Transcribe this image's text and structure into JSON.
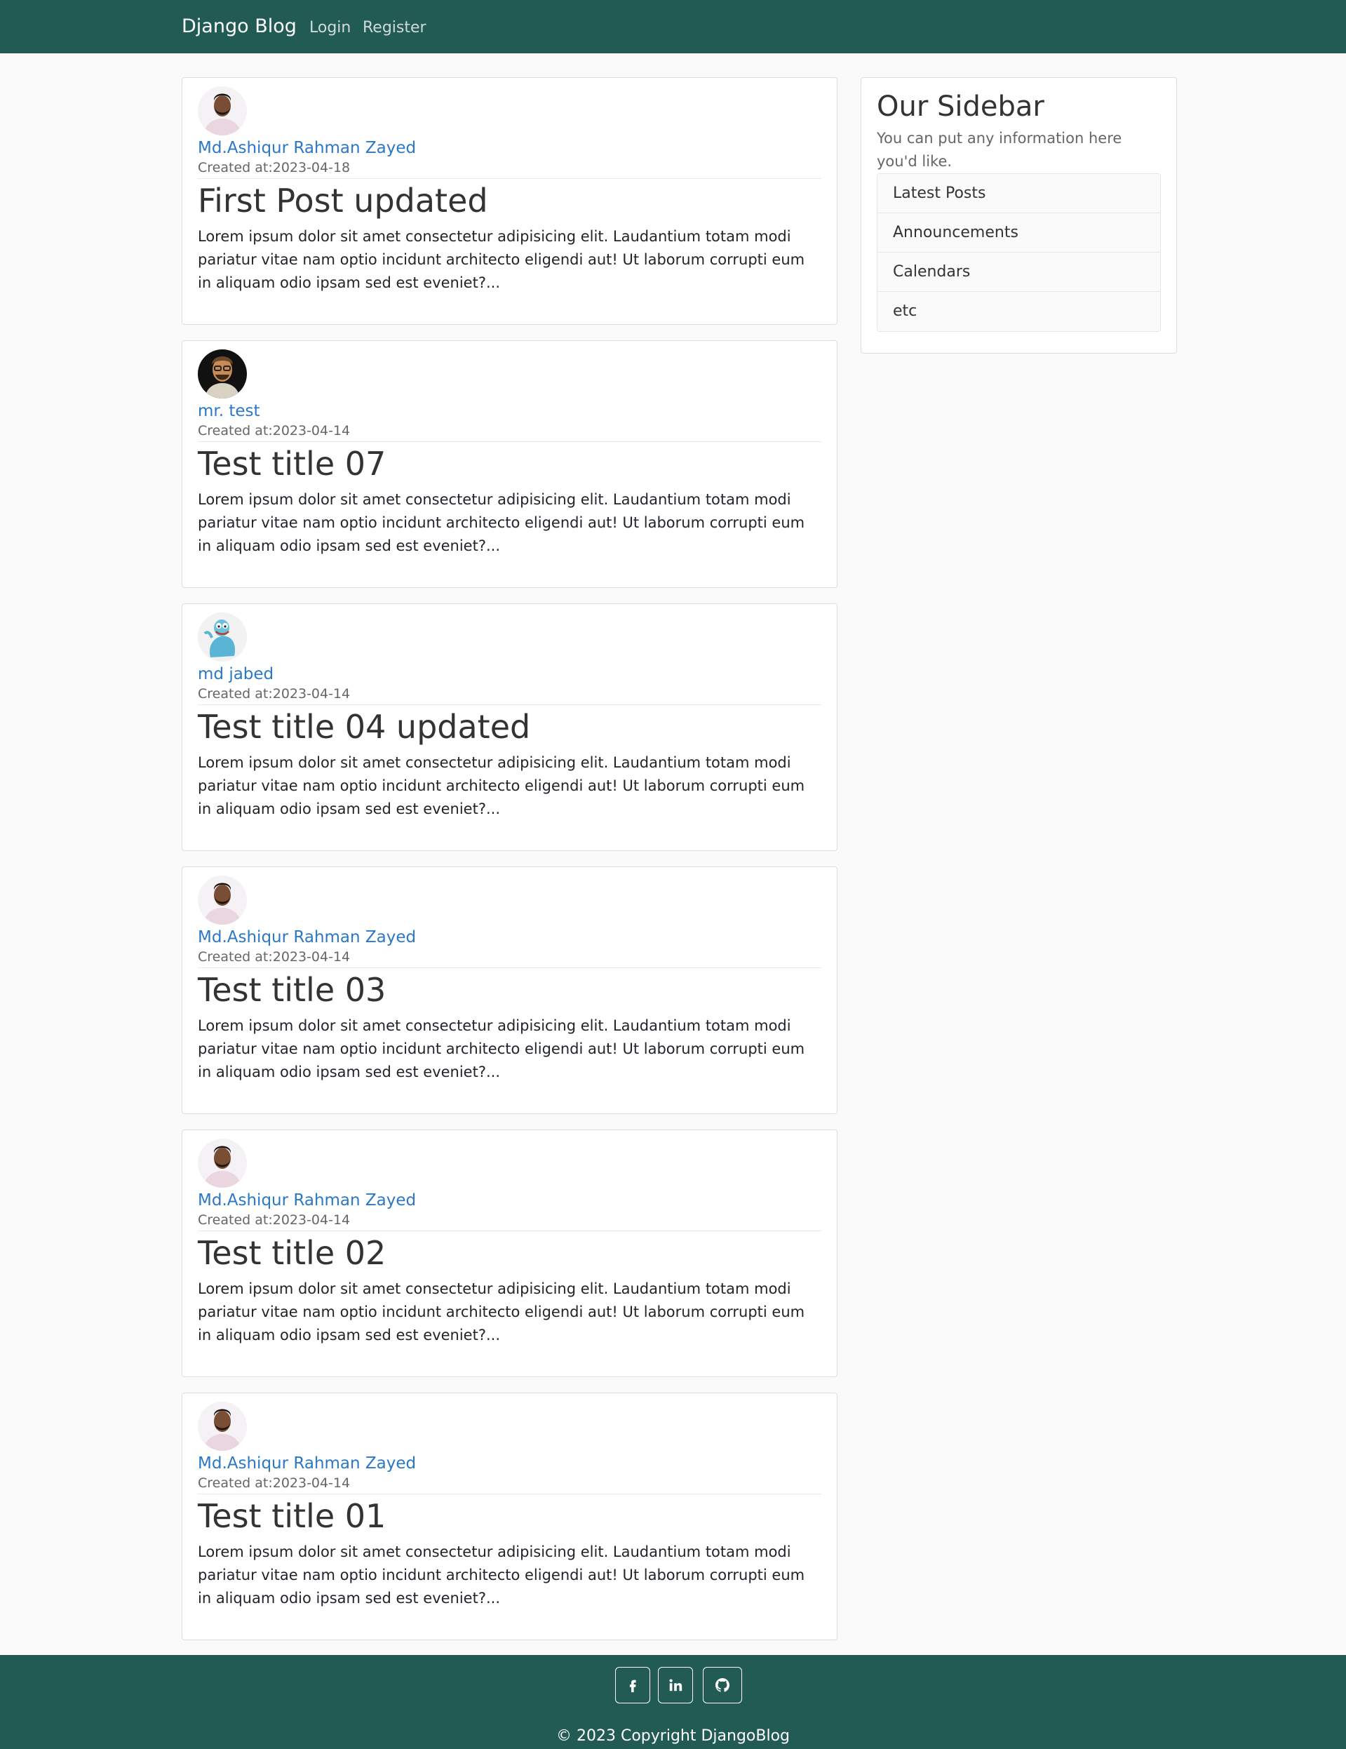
{
  "navbar": {
    "brand": "Django Blog",
    "links": [
      "Login",
      "Register"
    ]
  },
  "posts": [
    {
      "author": "Md.Ashiqur Rahman Zayed",
      "created": "Created at:2023-04-18",
      "title": "First Post updated",
      "excerpt": "Lorem ipsum dolor sit amet consectetur adipisicing elit. Laudantium totam modi pariatur vitae nam optio incidunt architecto eligendi aut! Ut laborum corrupti eum in aliquam odio ipsam sed est eveniet?..."
    },
    {
      "author": "mr. test",
      "created": "Created at:2023-04-14",
      "title": "Test title 07",
      "excerpt": "Lorem ipsum dolor sit amet consectetur adipisicing elit. Laudantium totam modi pariatur vitae nam optio incidunt architecto eligendi aut! Ut laborum corrupti eum in aliquam odio ipsam sed est eveniet?..."
    },
    {
      "author": "md jabed",
      "created": "Created at:2023-04-14",
      "title": "Test title 04 updated",
      "excerpt": "Lorem ipsum dolor sit amet consectetur adipisicing elit. Laudantium totam modi pariatur vitae nam optio incidunt architecto eligendi aut! Ut laborum corrupti eum in aliquam odio ipsam sed est eveniet?..."
    },
    {
      "author": "Md.Ashiqur Rahman Zayed",
      "created": "Created at:2023-04-14",
      "title": "Test title 03",
      "excerpt": "Lorem ipsum dolor sit amet consectetur adipisicing elit. Laudantium totam modi pariatur vitae nam optio incidunt architecto eligendi aut! Ut laborum corrupti eum in aliquam odio ipsam sed est eveniet?..."
    },
    {
      "author": "Md.Ashiqur Rahman Zayed",
      "created": "Created at:2023-04-14",
      "title": "Test title 02",
      "excerpt": "Lorem ipsum dolor sit amet consectetur adipisicing elit. Laudantium totam modi pariatur vitae nam optio incidunt architecto eligendi aut! Ut laborum corrupti eum in aliquam odio ipsam sed est eveniet?..."
    },
    {
      "author": "Md.Ashiqur Rahman Zayed",
      "created": "Created at:2023-04-14",
      "title": "Test title 01",
      "excerpt": "Lorem ipsum dolor sit amet consectetur adipisicing elit. Laudantium totam modi pariatur vitae nam optio incidunt architecto eligendi aut! Ut laborum corrupti eum in aliquam odio ipsam sed est eveniet?..."
    }
  ],
  "sidebar": {
    "title": "Our Sidebar",
    "description": "You can put any information here you'd like.",
    "items": [
      "Latest Posts",
      "Announcements",
      "Calendars",
      "etc"
    ]
  },
  "footer": {
    "social_icons": [
      "facebook-icon",
      "linkedin-icon",
      "github-icon"
    ],
    "copyright": "© 2023 Copyright DjangoBlog"
  },
  "colors": {
    "nav_bg": "#225a54",
    "link": "#2a78c6",
    "page_bg": "#fafafa"
  }
}
